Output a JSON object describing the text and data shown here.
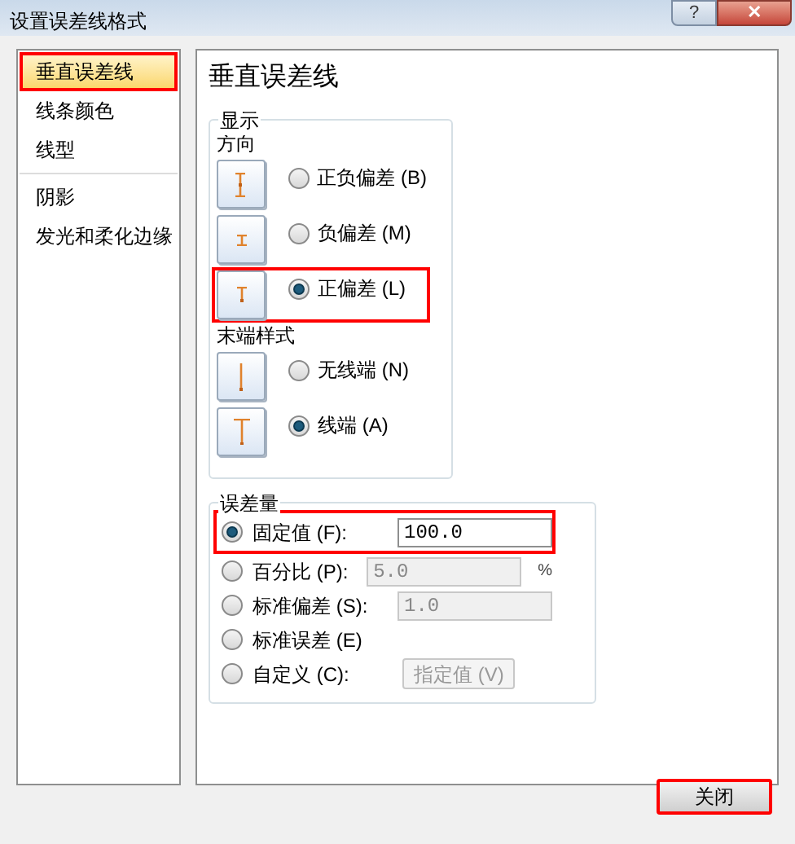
{
  "window": {
    "title": "设置误差线格式",
    "help": "?",
    "close": "✕"
  },
  "sidebar": {
    "items": [
      {
        "label": "垂直误差线",
        "selected": true,
        "highlighted": true
      },
      {
        "label": "线条颜色",
        "selected": false,
        "highlighted": false
      },
      {
        "label": "线型",
        "selected": false,
        "highlighted": false
      },
      {
        "label": "阴影",
        "selected": false,
        "highlighted": false,
        "divider_before": true
      },
      {
        "label": "发光和柔化边缘",
        "selected": false,
        "highlighted": false
      }
    ]
  },
  "panel": {
    "heading": "垂直误差线",
    "display": {
      "legend": "显示",
      "sections": [
        {
          "label": "方向",
          "options": [
            {
              "kind": "both",
              "label": "正负偏差 (B)",
              "selected": false,
              "highlighted": false
            },
            {
              "kind": "minus",
              "label": "负偏差 (M)",
              "selected": false,
              "highlighted": false
            },
            {
              "kind": "plus",
              "label": "正偏差 (L)",
              "selected": true,
              "highlighted": true
            }
          ]
        },
        {
          "label": "末端样式",
          "options": [
            {
              "kind": "nocap",
              "label": "无线端 (N)",
              "selected": false,
              "highlighted": false
            },
            {
              "kind": "cap",
              "label": "线端 (A)",
              "selected": true,
              "highlighted": false
            }
          ]
        }
      ]
    },
    "amount": {
      "legend": "误差量",
      "options": [
        {
          "kind": "field",
          "label": "固定值 (F):",
          "value": "100.0",
          "selected": true,
          "disabled": false,
          "highlighted": true
        },
        {
          "kind": "field",
          "label": "百分比 (P):",
          "value": "5.0",
          "unit": "%",
          "selected": false,
          "disabled": true,
          "highlighted": false
        },
        {
          "kind": "field",
          "label": "标准偏差 (S):",
          "value": "1.0",
          "selected": false,
          "disabled": true,
          "highlighted": false
        },
        {
          "kind": "plain",
          "label": "标准误差 (E)",
          "selected": false,
          "highlighted": false
        },
        {
          "kind": "button",
          "label": "自定义 (C):",
          "button": "指定值 (V)",
          "selected": false,
          "disabled": true,
          "highlighted": false
        }
      ]
    }
  },
  "footer": {
    "close_button": "关闭",
    "highlighted": true
  }
}
